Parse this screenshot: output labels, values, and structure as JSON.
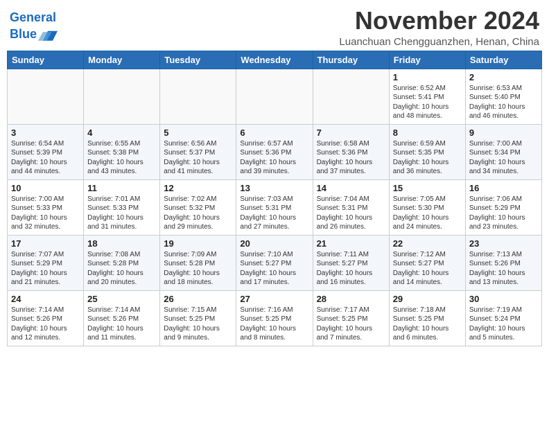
{
  "header": {
    "logo_line1": "General",
    "logo_line2": "Blue",
    "month": "November 2024",
    "location": "Luanchuan Chengguanzhen, Henan, China"
  },
  "weekdays": [
    "Sunday",
    "Monday",
    "Tuesday",
    "Wednesday",
    "Thursday",
    "Friday",
    "Saturday"
  ],
  "weeks": [
    [
      {
        "day": "",
        "info": ""
      },
      {
        "day": "",
        "info": ""
      },
      {
        "day": "",
        "info": ""
      },
      {
        "day": "",
        "info": ""
      },
      {
        "day": "",
        "info": ""
      },
      {
        "day": "1",
        "info": "Sunrise: 6:52 AM\nSunset: 5:41 PM\nDaylight: 10 hours and 48 minutes."
      },
      {
        "day": "2",
        "info": "Sunrise: 6:53 AM\nSunset: 5:40 PM\nDaylight: 10 hours and 46 minutes."
      }
    ],
    [
      {
        "day": "3",
        "info": "Sunrise: 6:54 AM\nSunset: 5:39 PM\nDaylight: 10 hours and 44 minutes."
      },
      {
        "day": "4",
        "info": "Sunrise: 6:55 AM\nSunset: 5:38 PM\nDaylight: 10 hours and 43 minutes."
      },
      {
        "day": "5",
        "info": "Sunrise: 6:56 AM\nSunset: 5:37 PM\nDaylight: 10 hours and 41 minutes."
      },
      {
        "day": "6",
        "info": "Sunrise: 6:57 AM\nSunset: 5:36 PM\nDaylight: 10 hours and 39 minutes."
      },
      {
        "day": "7",
        "info": "Sunrise: 6:58 AM\nSunset: 5:36 PM\nDaylight: 10 hours and 37 minutes."
      },
      {
        "day": "8",
        "info": "Sunrise: 6:59 AM\nSunset: 5:35 PM\nDaylight: 10 hours and 36 minutes."
      },
      {
        "day": "9",
        "info": "Sunrise: 7:00 AM\nSunset: 5:34 PM\nDaylight: 10 hours and 34 minutes."
      }
    ],
    [
      {
        "day": "10",
        "info": "Sunrise: 7:00 AM\nSunset: 5:33 PM\nDaylight: 10 hours and 32 minutes."
      },
      {
        "day": "11",
        "info": "Sunrise: 7:01 AM\nSunset: 5:33 PM\nDaylight: 10 hours and 31 minutes."
      },
      {
        "day": "12",
        "info": "Sunrise: 7:02 AM\nSunset: 5:32 PM\nDaylight: 10 hours and 29 minutes."
      },
      {
        "day": "13",
        "info": "Sunrise: 7:03 AM\nSunset: 5:31 PM\nDaylight: 10 hours and 27 minutes."
      },
      {
        "day": "14",
        "info": "Sunrise: 7:04 AM\nSunset: 5:31 PM\nDaylight: 10 hours and 26 minutes."
      },
      {
        "day": "15",
        "info": "Sunrise: 7:05 AM\nSunset: 5:30 PM\nDaylight: 10 hours and 24 minutes."
      },
      {
        "day": "16",
        "info": "Sunrise: 7:06 AM\nSunset: 5:29 PM\nDaylight: 10 hours and 23 minutes."
      }
    ],
    [
      {
        "day": "17",
        "info": "Sunrise: 7:07 AM\nSunset: 5:29 PM\nDaylight: 10 hours and 21 minutes."
      },
      {
        "day": "18",
        "info": "Sunrise: 7:08 AM\nSunset: 5:28 PM\nDaylight: 10 hours and 20 minutes."
      },
      {
        "day": "19",
        "info": "Sunrise: 7:09 AM\nSunset: 5:28 PM\nDaylight: 10 hours and 18 minutes."
      },
      {
        "day": "20",
        "info": "Sunrise: 7:10 AM\nSunset: 5:27 PM\nDaylight: 10 hours and 17 minutes."
      },
      {
        "day": "21",
        "info": "Sunrise: 7:11 AM\nSunset: 5:27 PM\nDaylight: 10 hours and 16 minutes."
      },
      {
        "day": "22",
        "info": "Sunrise: 7:12 AM\nSunset: 5:27 PM\nDaylight: 10 hours and 14 minutes."
      },
      {
        "day": "23",
        "info": "Sunrise: 7:13 AM\nSunset: 5:26 PM\nDaylight: 10 hours and 13 minutes."
      }
    ],
    [
      {
        "day": "24",
        "info": "Sunrise: 7:14 AM\nSunset: 5:26 PM\nDaylight: 10 hours and 12 minutes."
      },
      {
        "day": "25",
        "info": "Sunrise: 7:14 AM\nSunset: 5:26 PM\nDaylight: 10 hours and 11 minutes."
      },
      {
        "day": "26",
        "info": "Sunrise: 7:15 AM\nSunset: 5:25 PM\nDaylight: 10 hours and 9 minutes."
      },
      {
        "day": "27",
        "info": "Sunrise: 7:16 AM\nSunset: 5:25 PM\nDaylight: 10 hours and 8 minutes."
      },
      {
        "day": "28",
        "info": "Sunrise: 7:17 AM\nSunset: 5:25 PM\nDaylight: 10 hours and 7 minutes."
      },
      {
        "day": "29",
        "info": "Sunrise: 7:18 AM\nSunset: 5:25 PM\nDaylight: 10 hours and 6 minutes."
      },
      {
        "day": "30",
        "info": "Sunrise: 7:19 AM\nSunset: 5:24 PM\nDaylight: 10 hours and 5 minutes."
      }
    ]
  ]
}
